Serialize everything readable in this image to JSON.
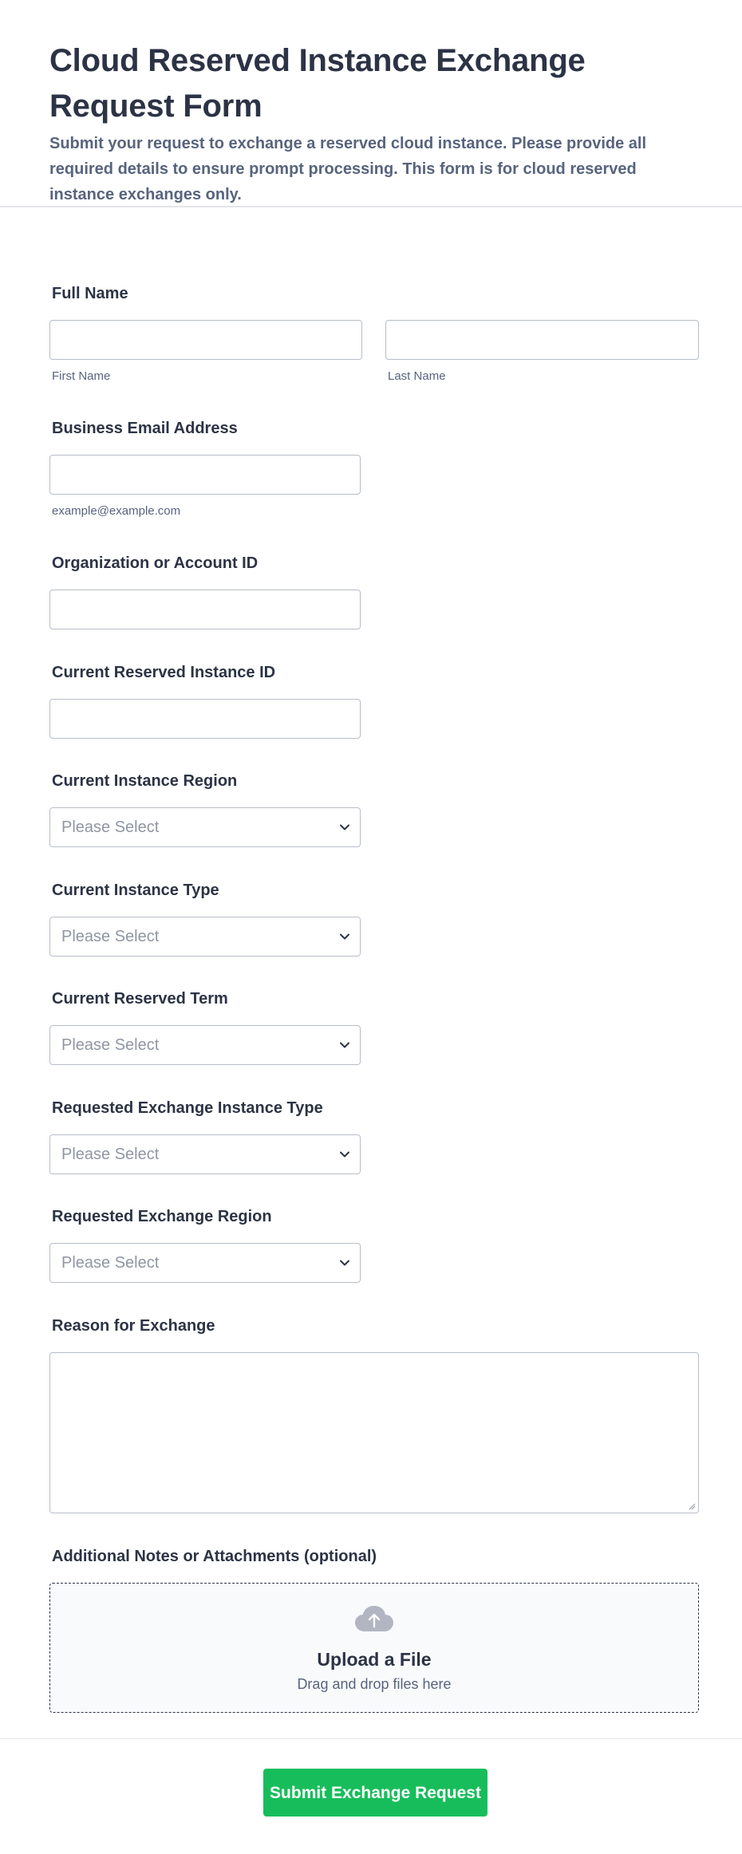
{
  "header": {
    "title": "Cloud Reserved Instance Exchange Request Form",
    "subtitle": "Submit your request to exchange a reserved cloud instance. Please provide all required details to ensure prompt processing. This form is for cloud reserved instance exchanges only."
  },
  "fields": {
    "full_name": {
      "label": "Full Name",
      "first_value": "",
      "first_sublabel": "First Name",
      "last_value": "",
      "last_sublabel": "Last Name"
    },
    "email": {
      "label": "Business Email Address",
      "value": "",
      "sublabel": "example@example.com"
    },
    "org_id": {
      "label": "Organization or Account ID",
      "value": ""
    },
    "current_ri_id": {
      "label": "Current Reserved Instance ID",
      "value": ""
    },
    "current_region": {
      "label": "Current Instance Region",
      "selected": "Please Select"
    },
    "current_type": {
      "label": "Current Instance Type",
      "selected": "Please Select"
    },
    "current_term": {
      "label": "Current Reserved Term",
      "selected": "Please Select"
    },
    "requested_type": {
      "label": "Requested Exchange Instance Type",
      "selected": "Please Select"
    },
    "requested_region": {
      "label": "Requested Exchange Region",
      "selected": "Please Select"
    },
    "reason": {
      "label": "Reason for Exchange",
      "value": ""
    },
    "attachments": {
      "label": "Additional Notes or Attachments (optional)",
      "upload_title": "Upload a File",
      "upload_hint": "Drag and drop files here",
      "icon": "cloud-upload-icon"
    }
  },
  "submit": {
    "label": "Submit Exchange Request"
  },
  "colors": {
    "accent": "#18bd5b",
    "text": "#2c3345",
    "muted": "#57647e",
    "border": "#b8bdc9",
    "placeholder": "#8f96a3"
  }
}
